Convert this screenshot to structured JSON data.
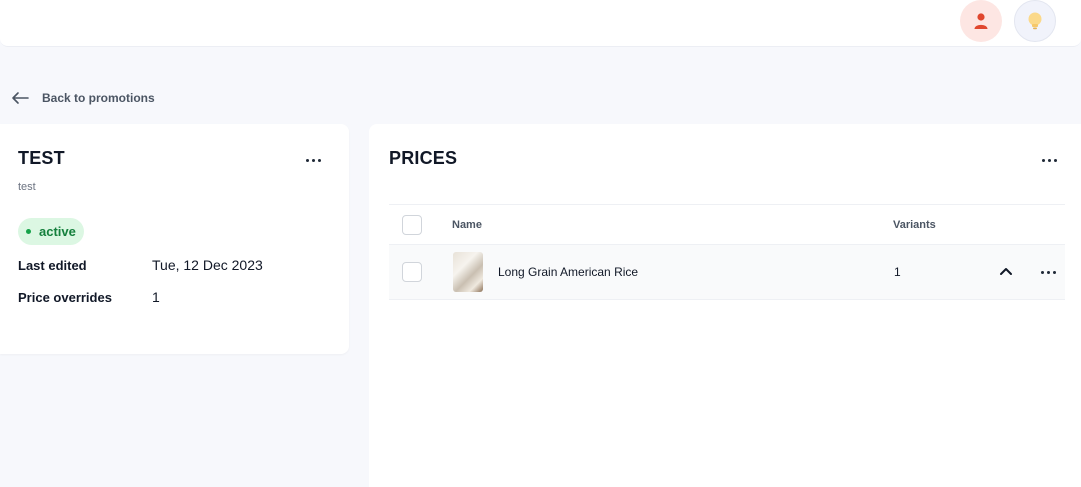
{
  "header": {
    "user_icon": "user-icon",
    "bulb_icon": "lightbulb-icon"
  },
  "nav": {
    "back_label": "Back to promotions"
  },
  "promotion": {
    "title": "TEST",
    "description": "test",
    "status": "active",
    "fields": [
      {
        "label": "Last edited",
        "value": "Tue, 12 Dec 2023"
      },
      {
        "label": "Price overrides",
        "value": "1"
      }
    ]
  },
  "prices": {
    "title": "PRICES",
    "columns": {
      "name": "Name",
      "variants": "Variants"
    },
    "rows": [
      {
        "name": "Long Grain American Rice",
        "variants": "1"
      }
    ]
  },
  "colors": {
    "accent_user": "#e0472f",
    "status_green": "#15803d",
    "badge_bg": "#dcf7e3"
  }
}
